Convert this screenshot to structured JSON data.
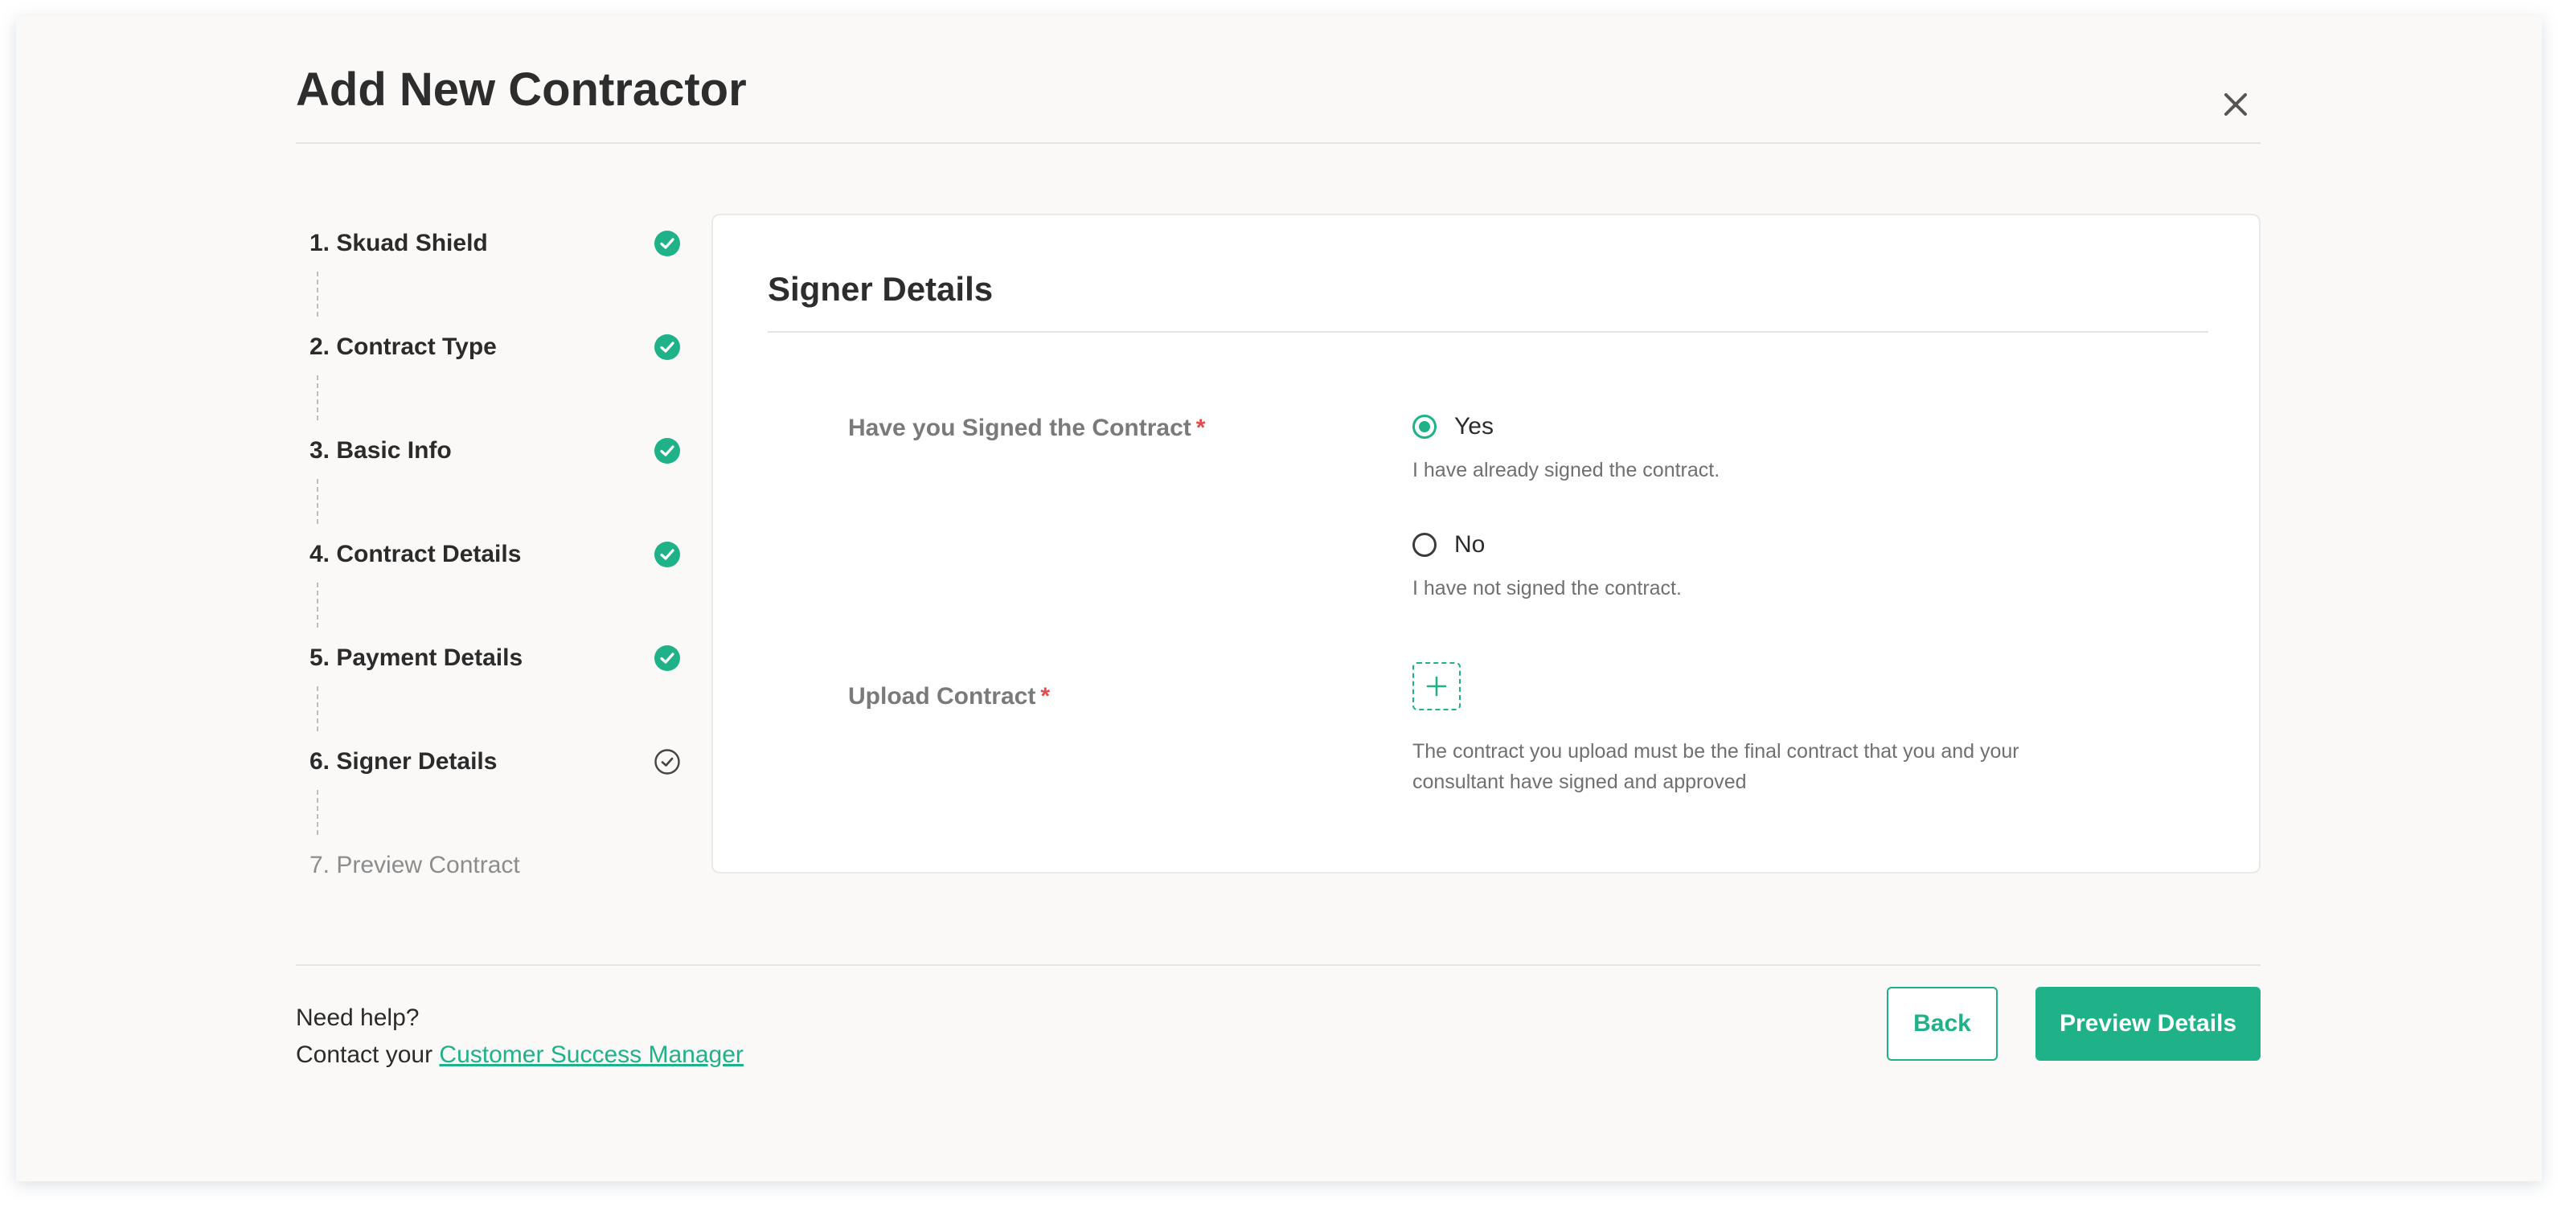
{
  "header": {
    "title": "Add New Contractor",
    "close_icon": "close-icon"
  },
  "colors": {
    "accent": "#1fb188",
    "required": "#e24d4d"
  },
  "stepper": {
    "steps": [
      {
        "label": "1. Skuad Shield",
        "status": "completed",
        "icon": "check-circle-filled-icon"
      },
      {
        "label": "2. Contract Type",
        "status": "completed",
        "icon": "check-circle-filled-icon"
      },
      {
        "label": "3. Basic Info",
        "status": "completed",
        "icon": "check-circle-filled-icon"
      },
      {
        "label": "4. Contract Details",
        "status": "completed",
        "icon": "check-circle-filled-icon"
      },
      {
        "label": "5. Payment Details",
        "status": "completed",
        "icon": "check-circle-filled-icon"
      },
      {
        "label": "6. Signer Details",
        "status": "current",
        "icon": "check-circle-outline-icon"
      },
      {
        "label": "7. Preview Contract",
        "status": "pending",
        "icon": ""
      }
    ]
  },
  "card": {
    "title": "Signer Details",
    "signed_question": {
      "label": "Have you Signed the Contract",
      "required_mark": "*",
      "options": [
        {
          "label": "Yes",
          "hint": "I have already signed the contract.",
          "checked": true
        },
        {
          "label": "No",
          "hint": "I have not signed the contract.",
          "checked": false
        }
      ]
    },
    "upload": {
      "label": "Upload Contract",
      "required_mark": "*",
      "button_icon": "plus-icon",
      "hint_line1": "The contract you upload must be the final contract that you and your",
      "hint_line2": "consultant have signed and approved"
    }
  },
  "footer": {
    "help_title": "Need help?",
    "help_prefix": "Contact your ",
    "help_link": "Customer Success Manager",
    "back_label": "Back",
    "preview_label": "Preview Details"
  }
}
